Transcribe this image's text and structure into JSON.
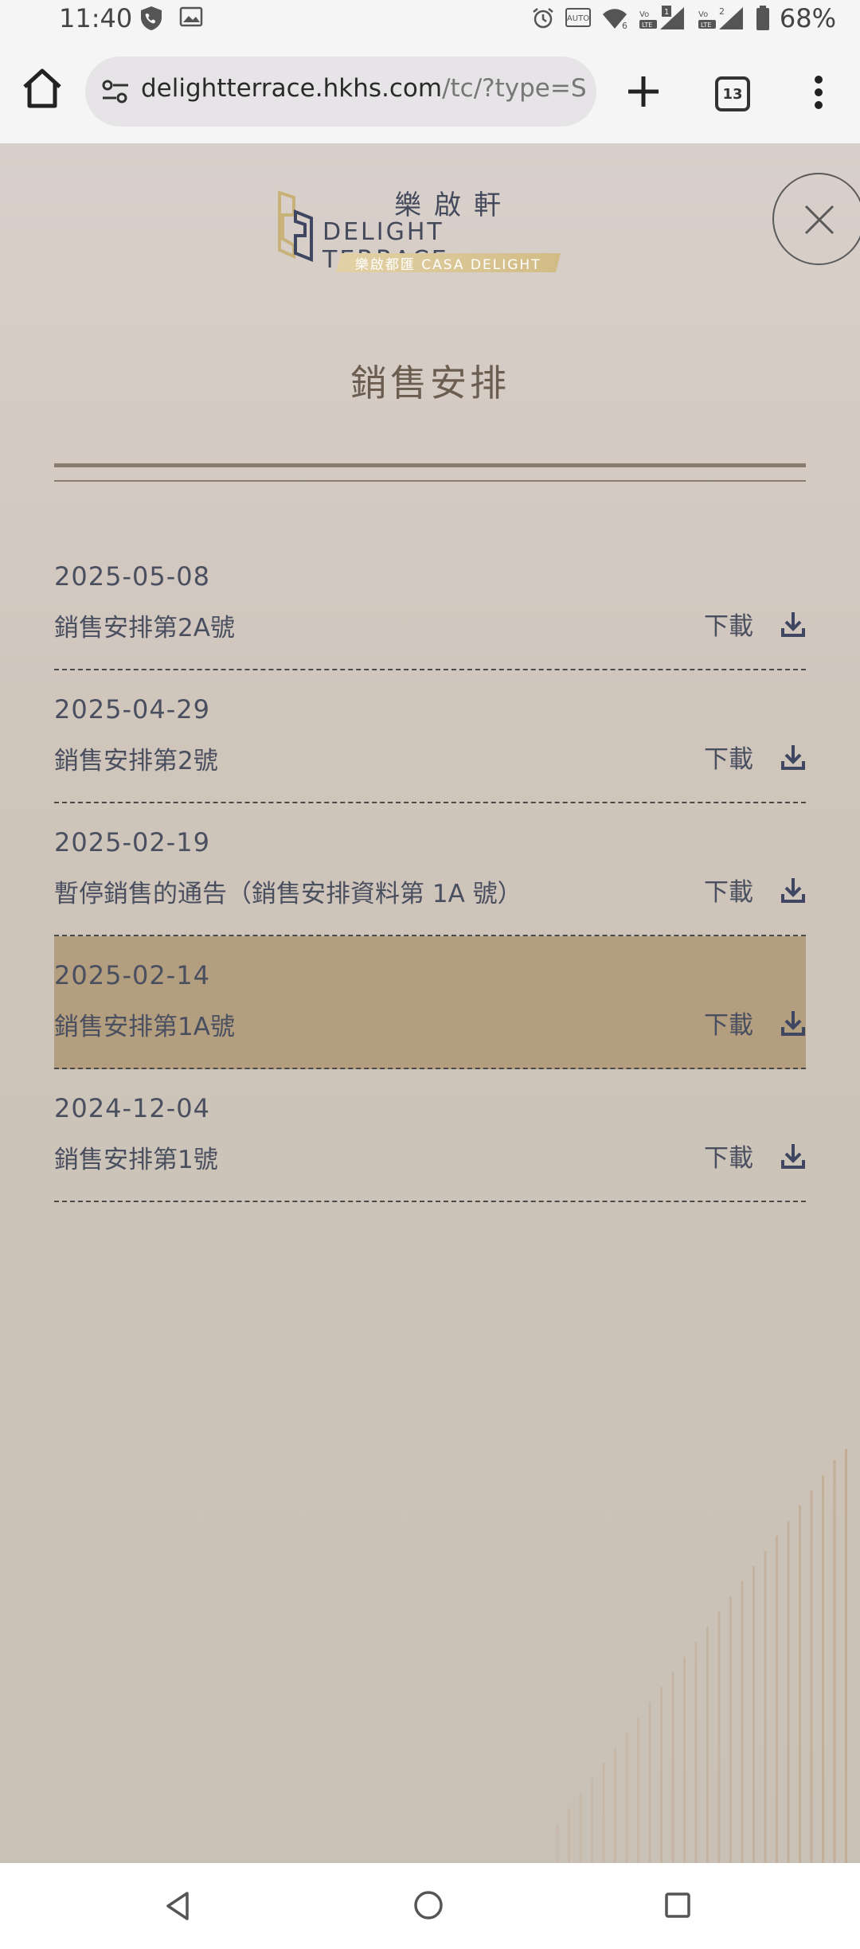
{
  "status_bar": {
    "time": "11:40",
    "battery": "68%",
    "left_icons": [
      "phone-shield-icon",
      "image-icon"
    ],
    "right_icons": [
      "alarm-icon",
      "auto-brightness-icon",
      "wifi-icon",
      "volte-signal-1-icon",
      "volte-signal-2-icon",
      "battery-icon"
    ]
  },
  "browser": {
    "url_host": "delightterrace.hkhs.com",
    "url_path": "/tc/?type=Sales+",
    "tab_count": "13"
  },
  "logo": {
    "cn": "樂啟軒",
    "en": "DELIGHT TERRACE",
    "sub": "樂啟都匯 CASA DELIGHT"
  },
  "page": {
    "title": "銷售安排"
  },
  "rows": [
    {
      "date": "2025-05-08",
      "title": "銷售安排第2A號",
      "download": "下載",
      "active": false
    },
    {
      "date": "2025-04-29",
      "title": "銷售安排第2號",
      "download": "下載",
      "active": false
    },
    {
      "date": "2025-02-19",
      "title": "暫停銷售的通告（銷售安排資料第 1A 號）",
      "download": "下載",
      "active": false
    },
    {
      "date": "2025-02-14",
      "title": "銷售安排第1A號",
      "download": "下載",
      "active": true
    },
    {
      "date": "2024-12-04",
      "title": "銷售安排第1號",
      "download": "下載",
      "active": false
    }
  ],
  "colors": {
    "accent_gold": "#d2bc86",
    "active_row": "#b39e7f",
    "text_navy": "#4a4f60",
    "title_brown": "#6b5d50"
  }
}
